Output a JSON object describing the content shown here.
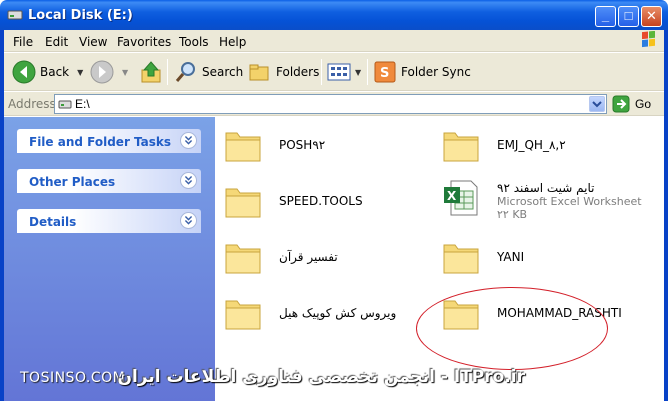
{
  "window": {
    "title": "Local Disk (E:)",
    "minimize_glyph": "_",
    "maximize_glyph": "□",
    "close_glyph": "✕"
  },
  "menu": {
    "items": [
      "File",
      "Edit",
      "View",
      "Favorites",
      "Tools",
      "Help"
    ]
  },
  "toolbar": {
    "back_label": "Back",
    "search_label": "Search",
    "folders_label": "Folders",
    "folder_sync_label": "Folder Sync"
  },
  "address": {
    "label": "Address",
    "value": "E:\\",
    "go_label": "Go"
  },
  "task_pane": {
    "panels": [
      {
        "title": "File and Folder Tasks"
      },
      {
        "title": "Other Places"
      },
      {
        "title": "Details"
      }
    ]
  },
  "files": {
    "items": [
      {
        "name": "POSH۹۲",
        "type": "folder"
      },
      {
        "name": "EMJ_QH_۸,۲",
        "type": "folder"
      },
      {
        "name": "SPEED.TOOLS",
        "type": "folder"
      },
      {
        "name": "تایم شیت اسفند ۹۲",
        "type": "excel",
        "detail": "Microsoft Excel Worksheet",
        "size": "۲۲ KB"
      },
      {
        "name": "تفسیر قرآن",
        "type": "folder"
      },
      {
        "name": "YANI",
        "type": "folder"
      },
      {
        "name": "ویروس کش کوپیک هیل",
        "type": "folder"
      },
      {
        "name": "MOHAMMAD_RASHTI",
        "type": "folder"
      }
    ]
  },
  "watermark": {
    "left": "TOSINSO.COM",
    "right": "ITPro.ir - انجمن تخصصی فناوری اطلاعات ایران"
  },
  "colors": {
    "title_bar": "#0552d6",
    "task_pane": "#6f8ee0",
    "panel_title": "#215dc6",
    "highlight_ellipse": "#d3202a",
    "folder_yellow": "#f5d878"
  }
}
